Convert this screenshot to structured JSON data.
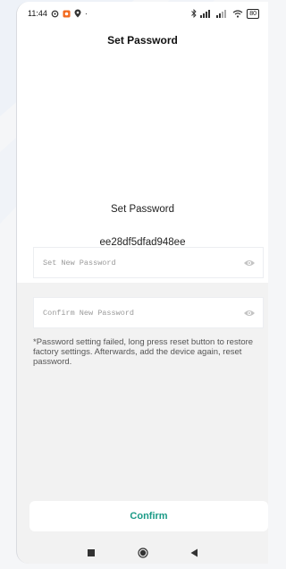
{
  "status": {
    "time": "11:44",
    "battery": "80"
  },
  "header": {
    "title": "Set Password"
  },
  "panel": {
    "heading": "Set Password",
    "device_id": "ee28df5dfad948ee"
  },
  "fields": {
    "new_password_placeholder": "Set New Password",
    "confirm_password_placeholder": "Confirm New Password"
  },
  "note": "*Password setting failed, long press reset button to restore factory settings. Afterwards, add the device again, reset password.",
  "actions": {
    "confirm_label": "Confirm"
  },
  "colors": {
    "accent": "#1a9a86"
  },
  "icons": [
    "settings-icon",
    "app-notification-icon",
    "location-icon",
    "bluetooth-icon",
    "signal-icon",
    "wifi-icon",
    "battery-icon",
    "eye-icon",
    "recent-apps-icon",
    "home-icon",
    "back-icon"
  ]
}
